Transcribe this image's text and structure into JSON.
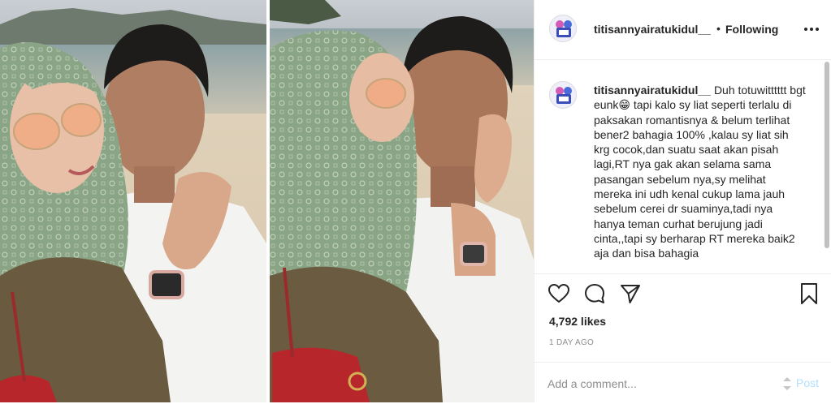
{
  "post": {
    "author": "titisannyairatukidul__",
    "separator": "•",
    "follow_status": "Following",
    "caption_text": "Duh totuwitttttt bgt eunk😁 tapi kalo sy liat seperti terlalu di paksakan romantisnya & belum terlihat bener2 bahagia 100% ,kalau sy liat sih krg cocok,dan suatu saat akan pisah lagi,RT nya gak akan selama sama pasangan sebelum nya,sy melihat mereka ini udh kenal cukup lama jauh sebelum cerei dr suaminya,tadi nya hanya teman curhat berujung jadi cinta,,tapi sy berharap RT mereka baik2 aja dan bisa bahagia",
    "likes": "4,792 likes",
    "time": "1 DAY AGO"
  },
  "comment_box": {
    "placeholder": "Add a comment...",
    "post_label": "Post"
  },
  "icons": {
    "avatar": "profile-avatar",
    "more": "more-options-icon",
    "like": "heart-icon",
    "comment": "comment-bubble-icon",
    "share": "paper-plane-icon",
    "save": "bookmark-icon"
  },
  "colors": {
    "post_button": "#b2dffc",
    "secondary_text": "#8e8e8e",
    "hijab_green": "#8aa585"
  }
}
